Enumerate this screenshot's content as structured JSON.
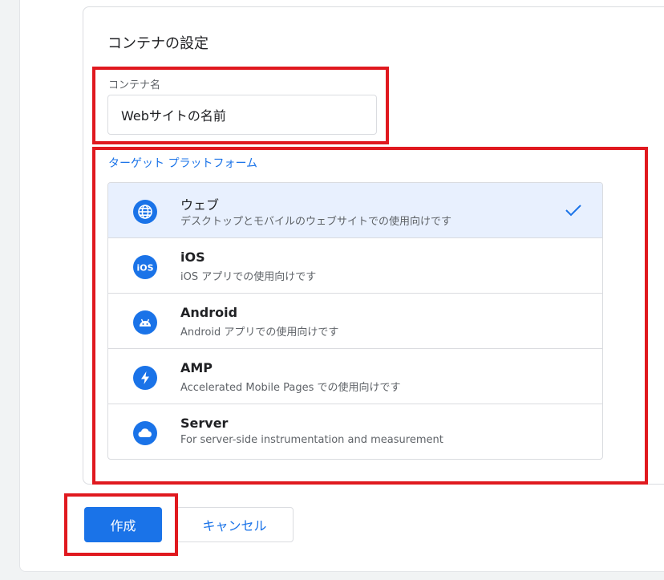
{
  "card": {
    "title": "コンテナの設定",
    "name_label": "コンテナ名",
    "name_value": "Webサイトの名前",
    "platform_label": "ターゲット プラットフォーム"
  },
  "platforms": [
    {
      "title": "ウェブ",
      "desc": "デスクトップとモバイルのウェブサイトでの使用向けです",
      "icon": "globe-icon",
      "selected": true
    },
    {
      "title": "iOS",
      "desc": "iOS アプリでの使用向けです",
      "icon": "ios-icon",
      "selected": false
    },
    {
      "title": "Android",
      "desc": "Android アプリでの使用向けです",
      "icon": "android-icon",
      "selected": false
    },
    {
      "title": "AMP",
      "desc": "Accelerated Mobile Pages での使用向けです",
      "icon": "bolt-icon",
      "selected": false
    },
    {
      "title": "Server",
      "desc": "For server-side instrumentation and measurement",
      "icon": "cloud-icon",
      "selected": false
    }
  ],
  "actions": {
    "create": "作成",
    "cancel": "キャンセル"
  },
  "colors": {
    "accent": "#1a73e8",
    "highlight": "#e0191f",
    "selected_bg": "#e8f0fe"
  }
}
